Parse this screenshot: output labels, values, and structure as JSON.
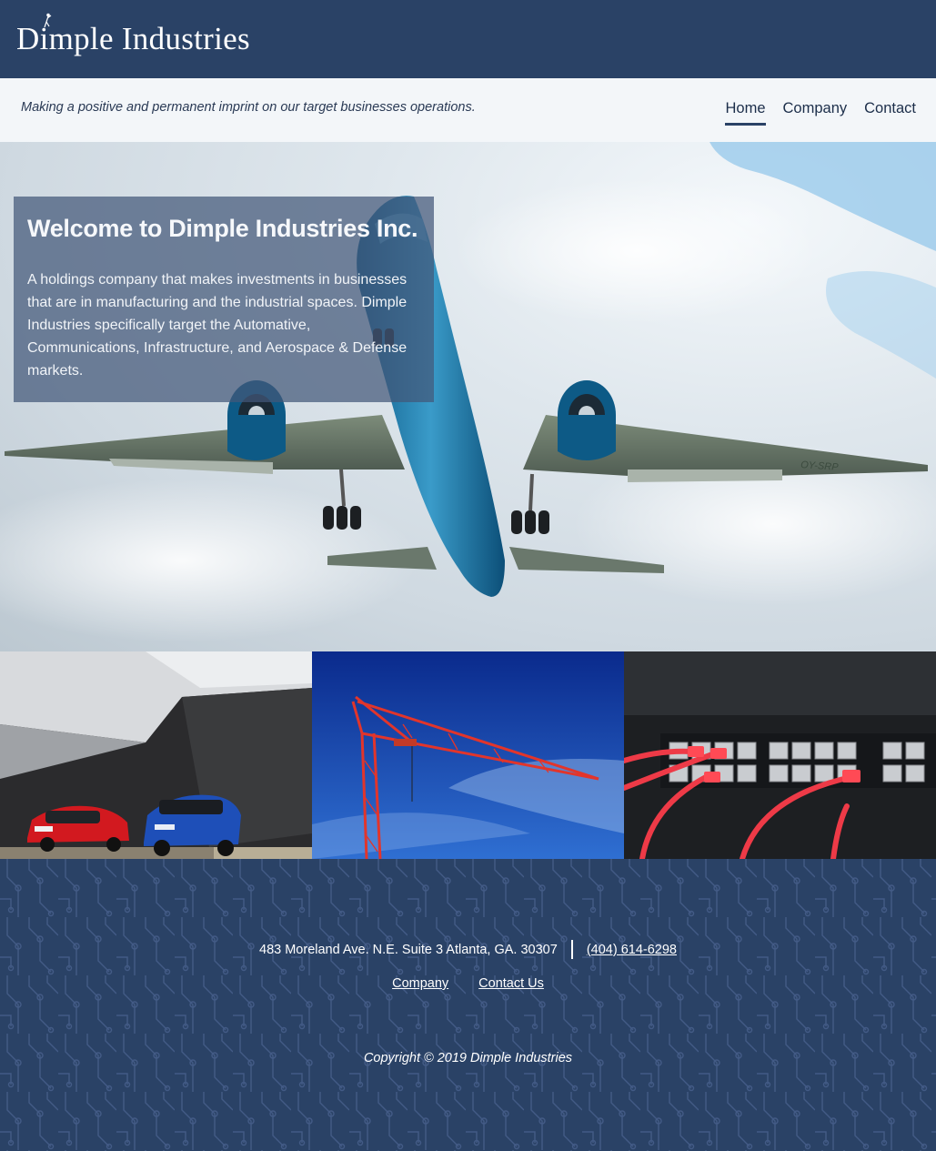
{
  "header": {
    "logo_text": "Dimple Industries",
    "tagline": "Making a positive and permanent imprint on our target businesses operations.",
    "nav": [
      {
        "label": "Home",
        "active": true
      },
      {
        "label": "Company",
        "active": false
      },
      {
        "label": "Contact",
        "active": false
      }
    ]
  },
  "hero": {
    "title": "Welcome to Dimple Industries Inc.",
    "body": "A holdings company that makes investments in businesses that are in manufacturing and the industrial spaces. Dimple Industries specifically target the Automative, Communications, Infrastructure, and Aerospace & Defense markets.",
    "aircraft_registration": "OY-SRP"
  },
  "footer": {
    "address": "483 Moreland Ave. N.E. Suite 3 Atlanta, GA. 30307",
    "phone": "(404) 614-6298",
    "links": [
      {
        "label": "Company"
      },
      {
        "label": "Contact Us"
      }
    ],
    "copyright": "Copyright © 2019 Dimple Industries"
  },
  "colors": {
    "navy": "#2a4266",
    "subbar": "#f3f6f9",
    "overlay": "#425878"
  }
}
